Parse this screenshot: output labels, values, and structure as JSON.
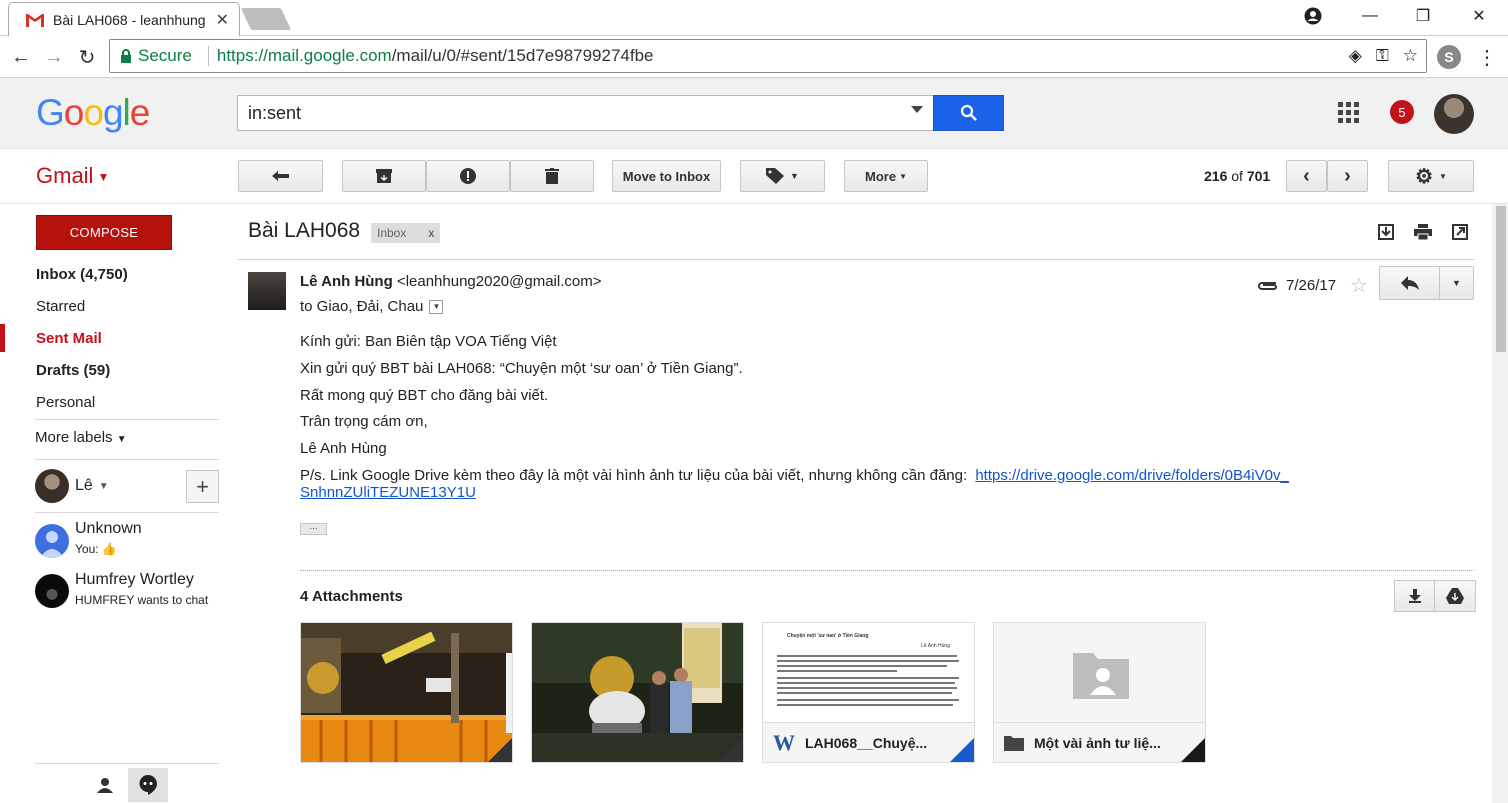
{
  "browser": {
    "tab_title": "Bài LAH068 - leanhhung",
    "secure_label": "Secure",
    "url_host": "https://mail.google.com",
    "url_path": "/mail/u/0/#sent/15d7e98799274fbe"
  },
  "header": {
    "logo_text": [
      "G",
      "o",
      "o",
      "g",
      "l",
      "e"
    ],
    "search_value": "in:sent",
    "notification_count": "5"
  },
  "toolbar": {
    "gmail_label": "Gmail",
    "move_to_inbox": "Move to Inbox",
    "more": "More",
    "counter_range": "216",
    "counter_of": "of",
    "counter_total": "701"
  },
  "sidebar": {
    "compose": "COMPOSE",
    "items": [
      {
        "label": "Inbox (4,750)",
        "style": "bold"
      },
      {
        "label": "Starred",
        "style": ""
      },
      {
        "label": "Sent Mail",
        "style": "active"
      },
      {
        "label": "Drafts (59)",
        "style": "bold"
      },
      {
        "label": "Personal",
        "style": ""
      }
    ],
    "more_labels": "More labels",
    "me_name": "Lê",
    "contacts": [
      {
        "name": "Unknown",
        "status": "You: 👍"
      },
      {
        "name": "Humfrey Wortley",
        "status": "HUMFREY wants to chat"
      }
    ]
  },
  "message": {
    "subject": "Bài LAH068",
    "tag": "Inbox",
    "tag_close": "x",
    "sender_name": "Lê Anh Hùng",
    "sender_email": "<leanhhung2020@gmail.com>",
    "to_line": "to Giao, Đải, Chau",
    "date": "7/26/17",
    "body": [
      "Kính gửi: Ban Biên tập VOA Tiếng Việt",
      "Xin gửi quý BBT bài LAH068: “Chuyện một ‘sư oan’ ở Tiền Giang”.",
      "Rất mong quý BBT cho đăng bài viết.",
      "Trân trọng cám ơn,",
      "Lê Anh Hùng"
    ],
    "ps_text": "P/s. Link Google Drive kèm theo đây là một vài hình ảnh tư liệu của bài viết, nhưng không cần đăng:",
    "ps_link_1": "https://drive.google.com/drive/folders/0B4iV0v_",
    "ps_link_2": "SnhnnZUliTEZUNE13Y1U",
    "attachments_title": "4 Attachments",
    "attachments": [
      {
        "name": ""
      },
      {
        "name": ""
      },
      {
        "name": "LAH068__Chuyệ...",
        "icon": "W"
      },
      {
        "name": "Một vài ảnh tư liệ..."
      }
    ],
    "doc_preview_title": "Chuyện một 'sư oan' ở Tiền Giang",
    "doc_preview_author": "Lê Anh Hùng"
  },
  "colors": {
    "gmail_red": "#c4121b",
    "search_blue": "#1a63e8",
    "link_blue": "#1155cc",
    "secure_green": "#0b8043"
  }
}
